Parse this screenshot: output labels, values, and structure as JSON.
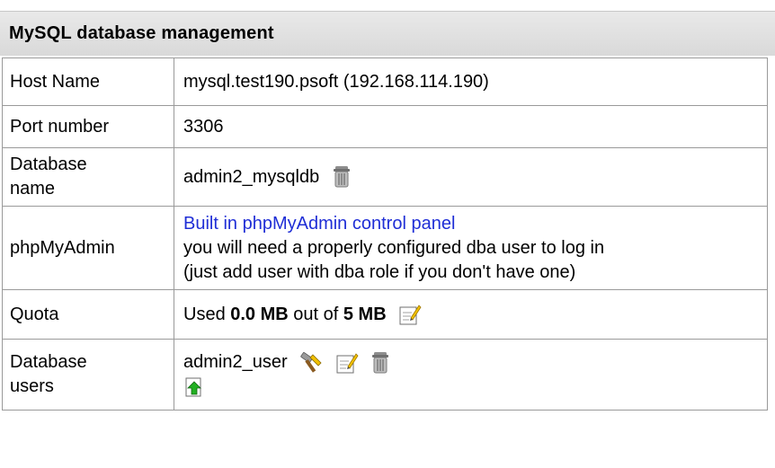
{
  "panel": {
    "title": "MySQL database management"
  },
  "rows": {
    "host": {
      "label": "Host Name",
      "value": "mysql.test190.psoft (192.168.114.190)"
    },
    "port": {
      "label": "Port number",
      "value": "3306"
    },
    "db": {
      "label_line1": "Database",
      "label_line2": "name",
      "value": "admin2_mysqldb"
    },
    "pma": {
      "label": "phpMyAdmin",
      "link": "Built in phpMyAdmin control panel",
      "line2": "you will need a properly configured dba user to log in",
      "line3": "(just add user with dba role if you don't have one)"
    },
    "quota": {
      "label": "Quota",
      "prefix": "Used ",
      "used": "0.0 MB",
      "middle": " out of ",
      "total": "5 MB"
    },
    "users": {
      "label_line1": "Database",
      "label_line2": "users",
      "user": "admin2_user"
    }
  },
  "icons": {
    "trash": "trash-icon",
    "edit": "edit-icon",
    "tools": "tools-icon",
    "add": "add-icon"
  }
}
